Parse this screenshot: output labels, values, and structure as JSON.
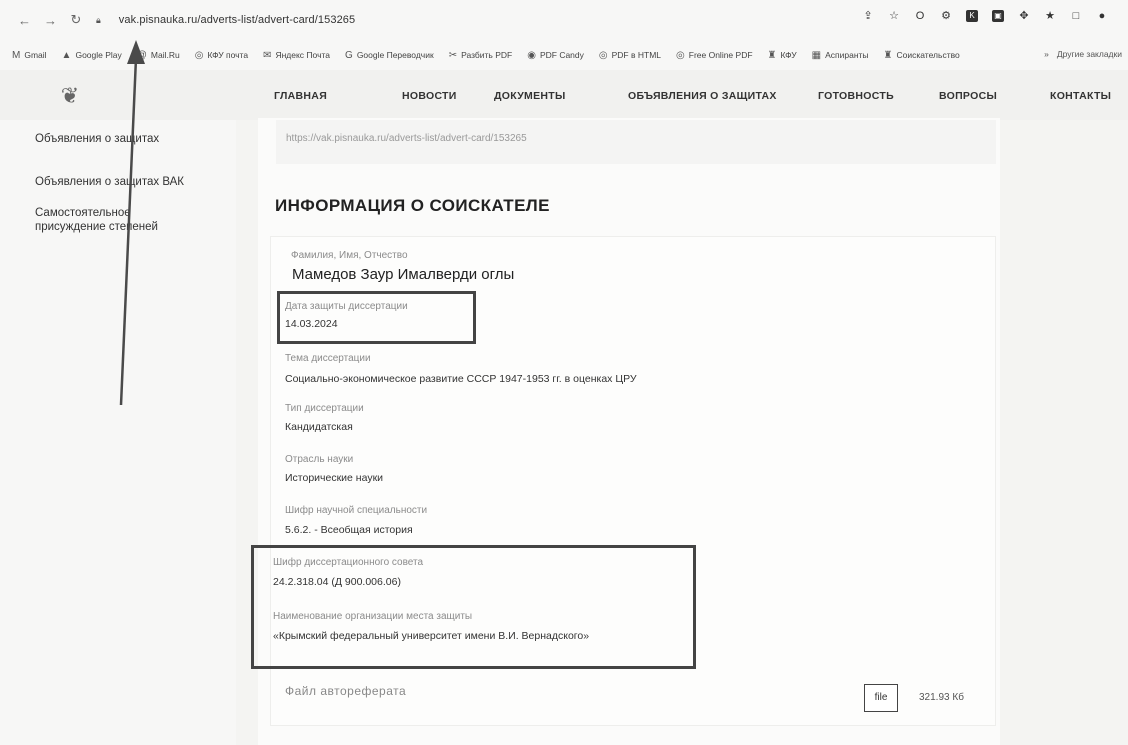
{
  "browser": {
    "url": "vak.pisnauka.ru/adverts-list/advert-card/153265",
    "bookmarks": [
      "Gmail",
      "Google Play",
      "Mail.Ru",
      "КФУ почта",
      "Яндекс Почта",
      "Google Переводчик",
      "Разбить PDF",
      "PDF Candy",
      "PDF в HTML",
      "Free Online PDF",
      "КФУ",
      "Аспиранты",
      "Соискательство"
    ],
    "bookmarks_more": "»",
    "bookmarks_other": "Другие закладки"
  },
  "header": {
    "menu": [
      "ГЛАВНАЯ",
      "НОВОСТИ",
      "ДОКУМЕНТЫ",
      "ОБЪЯВЛЕНИЯ О ЗАЩИТАХ",
      "ГОТОВНОСТЬ",
      "ВОПРОСЫ",
      "КОНТАКТЫ"
    ]
  },
  "sidebar": {
    "items": [
      "Объявления о защитах",
      "Объявления о защитах ВАК",
      "Самостоятельное присуждение степеней"
    ]
  },
  "link_block": {
    "url": "https://vak.pisnauka.ru/adverts-list/advert-card/153265"
  },
  "section": {
    "title": "ИНФОРМАЦИЯ О СОИСКАТЕЛЕ"
  },
  "fields": [
    {
      "label": "Фамилия, Имя, Отчество",
      "value": "Мамедов Заур Ималверди оглы"
    },
    {
      "label": "Дата защиты диссертации",
      "value": "14.03.2024"
    },
    {
      "label": "Тема диссертации",
      "value": "Социально-экономическое развитие СССР 1947-1953 гг. в оценках ЦРУ"
    },
    {
      "label": "Тип диссертации",
      "value": "Кандидатская"
    },
    {
      "label": "Отрасль науки",
      "value": "Исторические науки"
    },
    {
      "label": "Шифр научной специальности",
      "value": "5.6.2. - Всеобщая история"
    },
    {
      "label": "Шифр диссертационного совета",
      "value": "24.2.318.04 (Д 900.006.06)"
    },
    {
      "label": "Наименование организации места защиты",
      "value": "«Крымский федеральный университет имени В.И. Вернадского»"
    }
  ],
  "file": {
    "label": "Файл автореферата",
    "button": "file",
    "size": "321.93 Кб"
  },
  "colors": {
    "highlight_border": "#444444",
    "page_bg": "#f4f4f2"
  }
}
